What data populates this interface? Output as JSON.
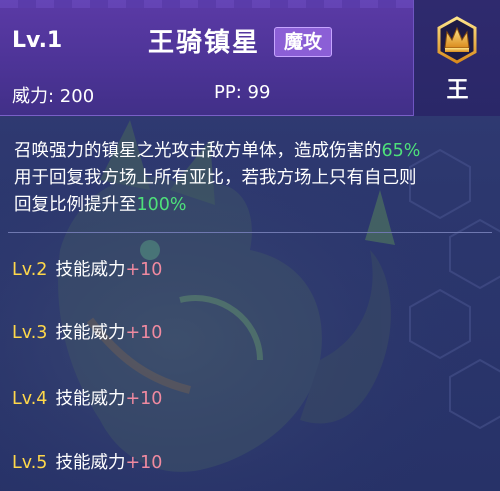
{
  "header": {
    "level": "Lv.1",
    "skill_name": "王骑镇星",
    "type_badge": "魔攻",
    "power_label": "威力: 200",
    "pp_label": "PP: 99",
    "rank_label": "王"
  },
  "description": {
    "part1": "召唤强力的镇星之光攻击敌方单体，造成伤害的",
    "part1_value": "65%",
    "part2": "用于回复我方场上所有亚比，若我方场上只有自己则回复比例提升至",
    "part2_value": "100%"
  },
  "upgrades": [
    {
      "level": "Lv.2",
      "text": "技能威力",
      "bonus": "+10"
    },
    {
      "level": "Lv.3",
      "text": "技能威力",
      "bonus": "+10"
    },
    {
      "level": "Lv.4",
      "text": "技能威力",
      "bonus": "+10"
    },
    {
      "level": "Lv.5",
      "text": "技能威力",
      "bonus": "+10"
    }
  ],
  "colors": {
    "header": "#4d3497",
    "badge": "#8b5fd6",
    "highlight_green": "#4ee07a",
    "level_yellow": "#ffd84a",
    "bonus_pink": "#f08aa0"
  },
  "icons": [
    "crown-gem-icon"
  ]
}
